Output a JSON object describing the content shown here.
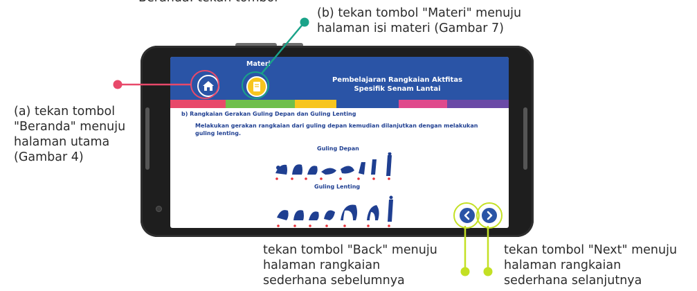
{
  "annotations": {
    "top_partial": "Beranda: tekan tombol",
    "materi": "(b) tekan tombol \"Materi\" menuju\nhalaman isi materi (Gambar 7)",
    "beranda": "(a) tekan tombol\n\"Beranda\" menuju\nhalaman utama\n(Gambar 4)",
    "back": "tekan tombol \"Back\" menuju\nhalaman rangkaian\nsederhana sebelumnya",
    "next": "tekan tombol \"Next\" menuju\nhalaman rangkaian\nsederhana selanjutnya"
  },
  "header": {
    "materi_label": "Materi",
    "title": "Pembelajaran Rangkaian Aktfitas Spesifik Senam Lantai"
  },
  "content": {
    "heading": "b) Rangkaian Gerakan Guling Depan dan Guling Lenting",
    "description": "Melakukan gerakan rangkaian dari guling depan kemudian dilanjutkan dengan melakukan guling lenting.",
    "figure1_title": "Guling Depan",
    "figure2_title": "Guling Lenting"
  },
  "icons": {
    "home": "home-icon",
    "materi": "book-icon",
    "back": "chevron-left-icon",
    "next": "chevron-right-icon"
  },
  "colors": {
    "header_blue": "#2a54a6",
    "pink_callout": "#e8496a",
    "teal_callout": "#1aa389",
    "lime_callout": "#c3e024",
    "yellow": "#f7c51e"
  }
}
